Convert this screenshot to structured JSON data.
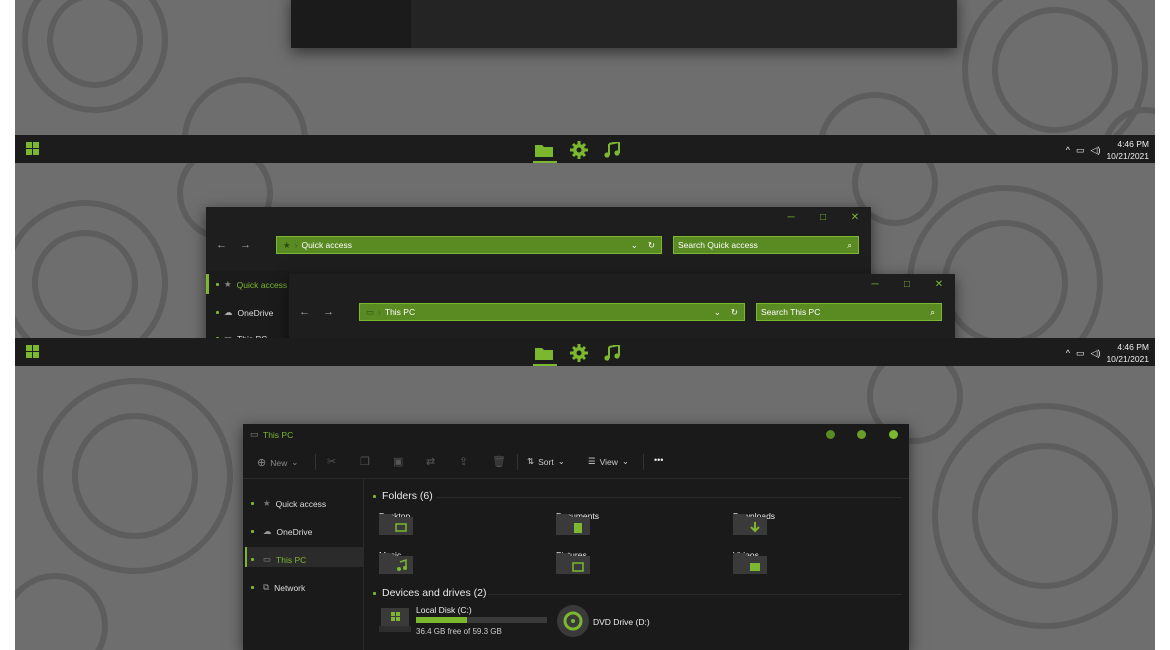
{
  "colors": {
    "accent": "#7cb82f",
    "accent_dark": "#5a8a22",
    "taskbar": "#1c1c1c",
    "window": "#1e1e1e",
    "desktop": "#6e6e6e"
  },
  "taskbar": {
    "time": "4:46 PM",
    "date": "10/21/2021",
    "apps": [
      {
        "icon": "folder-icon"
      },
      {
        "icon": "gear-icon"
      },
      {
        "icon": "music-note-icon"
      }
    ],
    "tray_icons": [
      "chevron-up-icon",
      "network-icon",
      "volume-icon"
    ]
  },
  "win_quick": {
    "address": "Quick access",
    "search": "Search Quick access",
    "sidebar": [
      "Quick access",
      "OneDrive",
      "This PC"
    ]
  },
  "win_thispc_small": {
    "address": "This PC",
    "search": "Search This PC"
  },
  "win_main": {
    "title": "This PC",
    "toolbar": {
      "new": "New",
      "sort": "Sort",
      "view": "View",
      "more": "•••"
    },
    "sidebar": [
      "Quick access",
      "OneDrive",
      "This PC",
      "Network"
    ],
    "folders_header": "Folders (6)",
    "folders": [
      "Desktop",
      "Documents",
      "Downloads",
      "Music",
      "Pictures",
      "Videos"
    ],
    "devices_header": "Devices and drives (2)",
    "drives": [
      {
        "name": "Local Disk (C:)",
        "info": "36.4 GB free of 59.3 GB",
        "used_fraction": 0.39
      },
      {
        "name": "DVD Drive (D:)"
      }
    ]
  }
}
